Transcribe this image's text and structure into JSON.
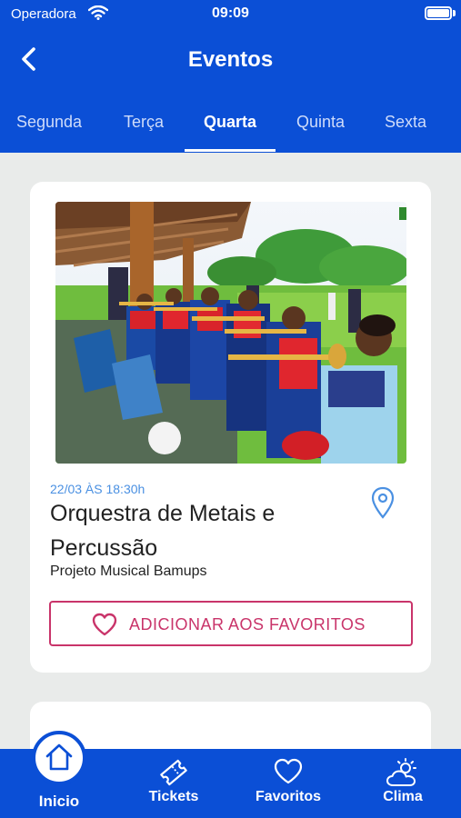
{
  "status": {
    "carrier": "Operadora",
    "time": "09:09"
  },
  "nav": {
    "title": "Eventos"
  },
  "tabs": [
    {
      "label": "Segunda"
    },
    {
      "label": "Terça"
    },
    {
      "label": "Quarta"
    },
    {
      "label": "Quinta"
    },
    {
      "label": "Sexta"
    }
  ],
  "active_tab": "Quarta",
  "event": {
    "date": "22/03 ÀS 18:30h",
    "title": "Orquestra de Metais e Percussão",
    "organizer": "Projeto Musical Bamups",
    "favorite_label": "ADICIONAR AOS FAVORITOS",
    "image_icon": "band-photo"
  },
  "tabbar": {
    "items": [
      {
        "label": "Inicio",
        "icon": "home-icon"
      },
      {
        "label": "Tickets",
        "icon": "ticket-icon"
      },
      {
        "label": "Favoritos",
        "icon": "heart-icon"
      },
      {
        "label": "Clima",
        "icon": "weather-icon"
      }
    ]
  },
  "colors": {
    "primary": "#0b4fd6",
    "accent": "#c9346a",
    "date": "#4a90e2",
    "background": "#e9ebea"
  }
}
